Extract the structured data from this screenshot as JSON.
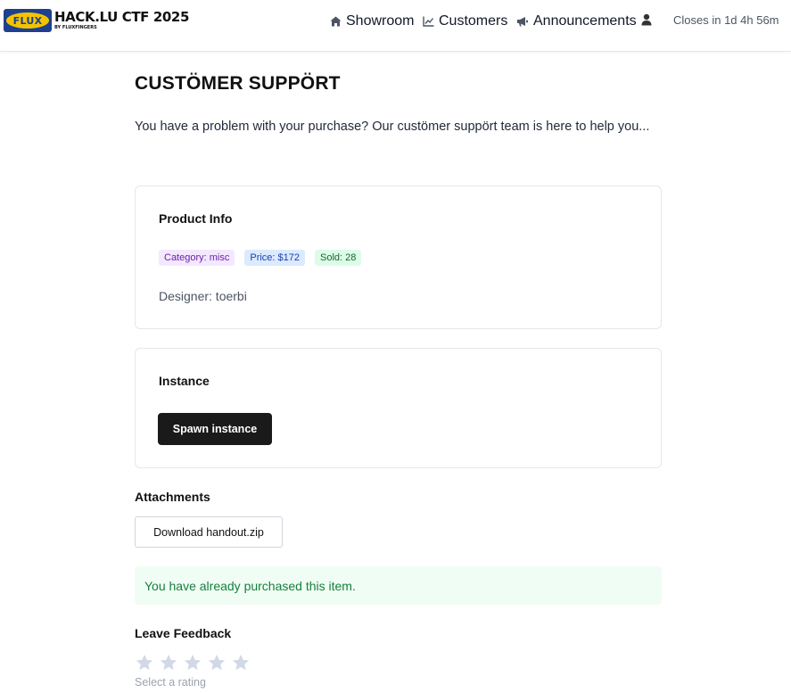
{
  "header": {
    "logo_badge": "FLUX",
    "logo_title": "HACK.LU CTF 2025",
    "logo_sub": "BY FLUXFINGERS",
    "nav": {
      "showroom": "Showroom",
      "customers": "Customers",
      "announcements": "Announcements",
      "closes": "Closes in 1d 4h 56m"
    },
    "icons": {
      "showroom": "home-icon",
      "customers": "chart-line-icon",
      "announcements": "megaphone-icon",
      "user": "user-icon"
    }
  },
  "main": {
    "title": "CUSTÖMER SUPPÖRT",
    "intro": "You have a problem with your purchase? Our custömer suppört team is here to help you...",
    "product_info": {
      "title": "Product Info",
      "badges": {
        "category": "Category: misc",
        "price": "Price: $172",
        "sold": "Sold: 28"
      },
      "designer": "Designer: toerbi"
    },
    "instance": {
      "title": "Instance",
      "spawn_label": "Spawn instance"
    },
    "attachments": {
      "title": "Attachments",
      "download_label": "Download handout.zip"
    },
    "purchased_notice": "You have already purchased this item.",
    "feedback": {
      "title": "Leave Feedback",
      "rating_hint": "Select a rating",
      "stars": 5
    }
  },
  "colors": {
    "flux_blue": "#1f3f8f",
    "flux_yellow": "#f3c400",
    "success_bg": "#f0fdf4",
    "success_text": "#15803d",
    "star_inactive": "#d1d9e6"
  }
}
